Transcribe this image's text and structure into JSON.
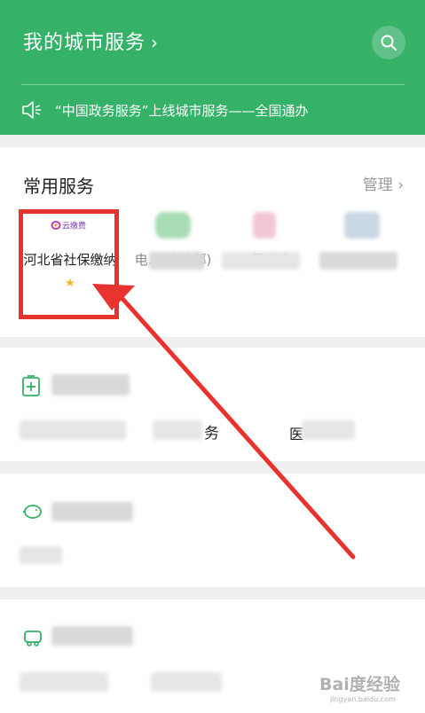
{
  "header": {
    "title": "我的城市服务",
    "title_chevron": "›",
    "notice": "“中国政务服务”上线城市服务——全国通办"
  },
  "common": {
    "title": "常用服务",
    "manage": "管理 ›",
    "services": [
      {
        "label": "河北省社保缴纳",
        "logo_text": "云缴费",
        "favorite": "★"
      },
      {
        "label": "电…(人社部)"
      },
      {
        "label": "…保健康"
      },
      {
        "label": ""
      }
    ]
  },
  "colors": {
    "brand_green": "#35b168",
    "highlight_red": "#e8322d",
    "star": "#f2b824"
  },
  "icons": [
    "search-icon",
    "speaker-icon",
    "chevron-right-icon",
    "medical-icon",
    "piggy-bank-icon",
    "car-icon"
  ],
  "sections": {
    "row2_middle": "务",
    "row2_right": "医"
  },
  "watermark": {
    "brand": "Bai度经验",
    "url": "jingyan.baidu.com"
  }
}
